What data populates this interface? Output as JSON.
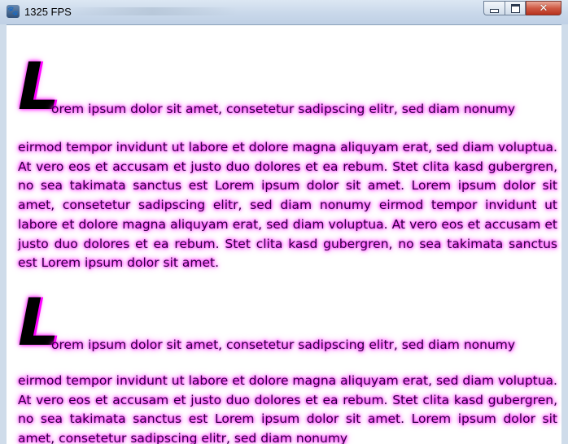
{
  "window": {
    "title": "1325 FPS",
    "controls": {
      "minimize": "minimize",
      "maximize": "maximize",
      "close": "close"
    }
  },
  "paragraphs": [
    {
      "dropcap": "L",
      "first_line": "orem ipsum dolor sit amet, consetetur sadipscing elitr, sed diam nonumy",
      "body": "eirmod tempor invidunt ut labore et dolore magna aliquyam erat, sed diam voluptua. At vero eos et accusam et justo duo dolores et ea rebum. Stet clita kasd gubergren, no sea takimata sanctus est Lorem ipsum dolor sit amet. Lorem ipsum dolor sit amet, consetetur sadipscing elitr, sed diam nonumy eirmod tempor invidunt ut labore et dolore magna aliquyam erat, sed diam voluptua. At vero eos et accusam et justo duo dolores et ea rebum. Stet clita kasd gubergren, no sea takimata sanctus est Lorem ipsum dolor sit amet."
    },
    {
      "dropcap": "L",
      "first_line": "orem ipsum dolor sit amet, consetetur sadipscing elitr, sed diam nonumy",
      "body": "eirmod tempor invidunt ut labore et dolore magna aliquyam erat, sed diam voluptua. At vero eos et accusam et justo duo dolores et ea rebum. Stet clita kasd gubergren, no sea takimata sanctus est Lorem ipsum dolor sit amet. Lorem ipsum dolor sit amet, consetetur sadipscing elitr, sed diam nonumy"
    }
  ],
  "colors": {
    "glow": "#ff00ff",
    "text": "#2e0040",
    "dropcap": "#000000"
  }
}
